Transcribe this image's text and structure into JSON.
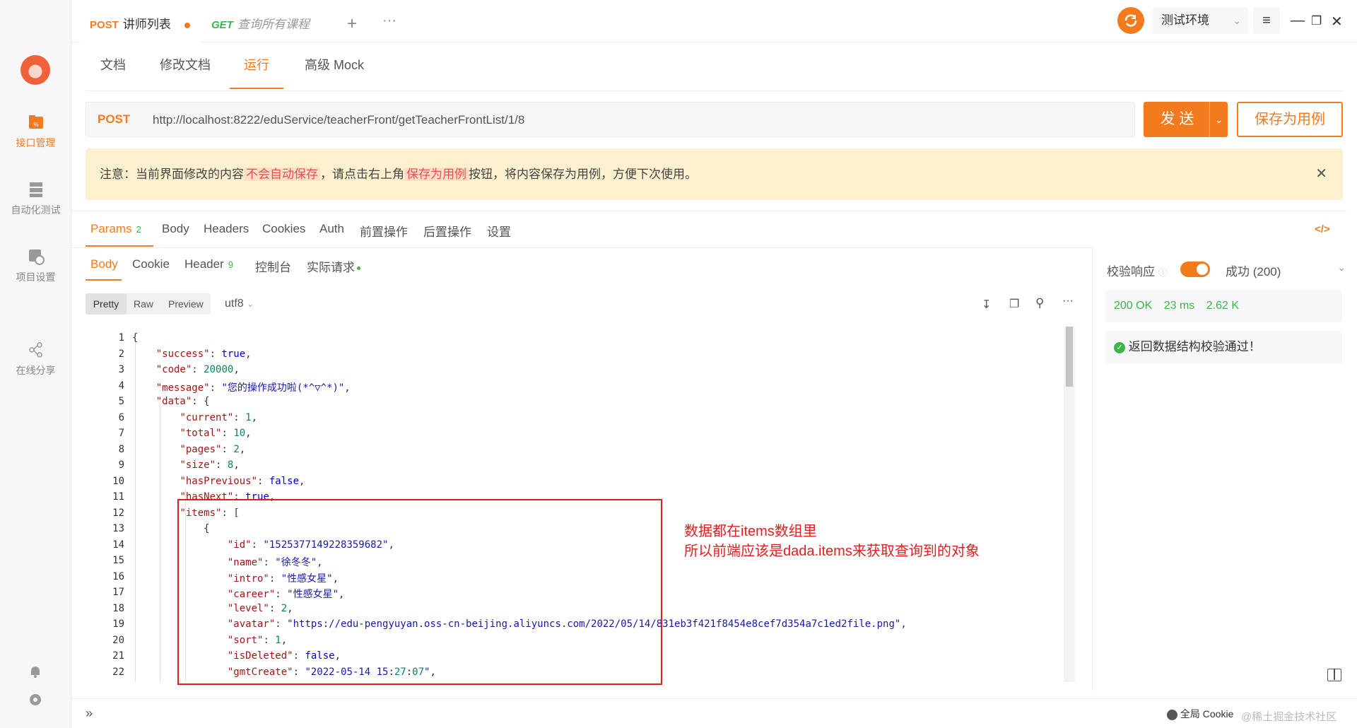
{
  "sidebar": {
    "items": [
      {
        "label": "接口管理"
      },
      {
        "label": "自动化测试"
      },
      {
        "label": "项目设置"
      },
      {
        "label": "在线分享"
      }
    ]
  },
  "tabs": [
    {
      "method": "POST",
      "name": "讲师列表"
    },
    {
      "method": "GET",
      "name": "查询所有课程"
    }
  ],
  "env": {
    "label": "测试环境"
  },
  "subtabs": [
    "文档",
    "修改文档",
    "运行",
    "高级 Mock"
  ],
  "request": {
    "method": "POST",
    "url": "http://localhost:8222/eduService/teacherFront/getTeacherFrontList/1/8",
    "send_label": "发 送",
    "save_label": "保存为用例"
  },
  "notice": {
    "prefix": "注意：当前界面修改的内容",
    "hl1": "不会自动保存",
    "middle": "，请点击右上角",
    "hl2": "保存为用例",
    "suffix": "按钮，将内容保存为用例，方便下次使用。"
  },
  "param_tabs": [
    "Params",
    "Body",
    "Headers",
    "Cookies",
    "Auth",
    "前置操作",
    "后置操作",
    "设置"
  ],
  "params_count": "2",
  "resp_tabs": [
    "Body",
    "Cookie",
    "Header",
    "控制台",
    "实际请求"
  ],
  "header_count": "9",
  "view_modes": [
    "Pretty",
    "Raw",
    "Preview"
  ],
  "encoding": "utf8",
  "code_lines": [
    "{",
    "    \"success\": true,",
    "    \"code\": 20000,",
    "    \"message\": \"您的操作成功啦(*^▽^*)\",",
    "    \"data\": {",
    "        \"current\": 1,",
    "        \"total\": 10,",
    "        \"pages\": 2,",
    "        \"size\": 8,",
    "        \"hasPrevious\": false,",
    "        \"hasNext\": true,",
    "        \"items\": [",
    "            {",
    "                \"id\": \"1525377149228359682\",",
    "                \"name\": \"徐冬冬\",",
    "                \"intro\": \"性感女星\",",
    "                \"career\": \"性感女星\",",
    "                \"level\": 2,",
    "                \"avatar\": \"https://edu-pengyuyan.oss-cn-beijing.aliyuncs.com/2022/05/14/831eb3f421f8454e8cef7d354a7c1ed2file.png\",",
    "                \"sort\": 1,",
    "                \"isDeleted\": false,",
    "                \"gmtCreate\": \"2022-05-14 15:27:07\","
  ],
  "annotation": {
    "line1": "数据都在items数组里",
    "line2": "所以前端应该是dada.items来获取查询到的对象"
  },
  "validation": {
    "label": "校验响应",
    "status": "成功 (200)",
    "code": "200 OK",
    "time": "23 ms",
    "size": "2.62 K",
    "message": "返回数据结构校验通过！"
  },
  "footer": {
    "cookie": "全局 Cookie",
    "watermark": "@稀土掘金技术社区"
  },
  "colors": {
    "accent": "#f37b1d",
    "success": "#3db34a",
    "annotation": "#e02020"
  }
}
